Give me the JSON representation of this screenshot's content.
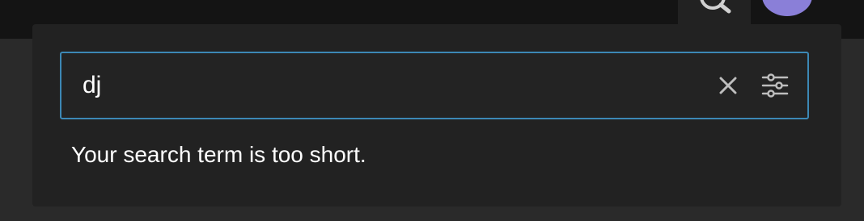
{
  "header": {
    "search_toggle_icon": "search-icon",
    "avatar": "avatar"
  },
  "search": {
    "value": "dj",
    "clear_icon": "close-icon",
    "filter_icon": "sliders-icon",
    "accent_color": "#3c88b5"
  },
  "message": {
    "text": "Your search term is too short."
  }
}
